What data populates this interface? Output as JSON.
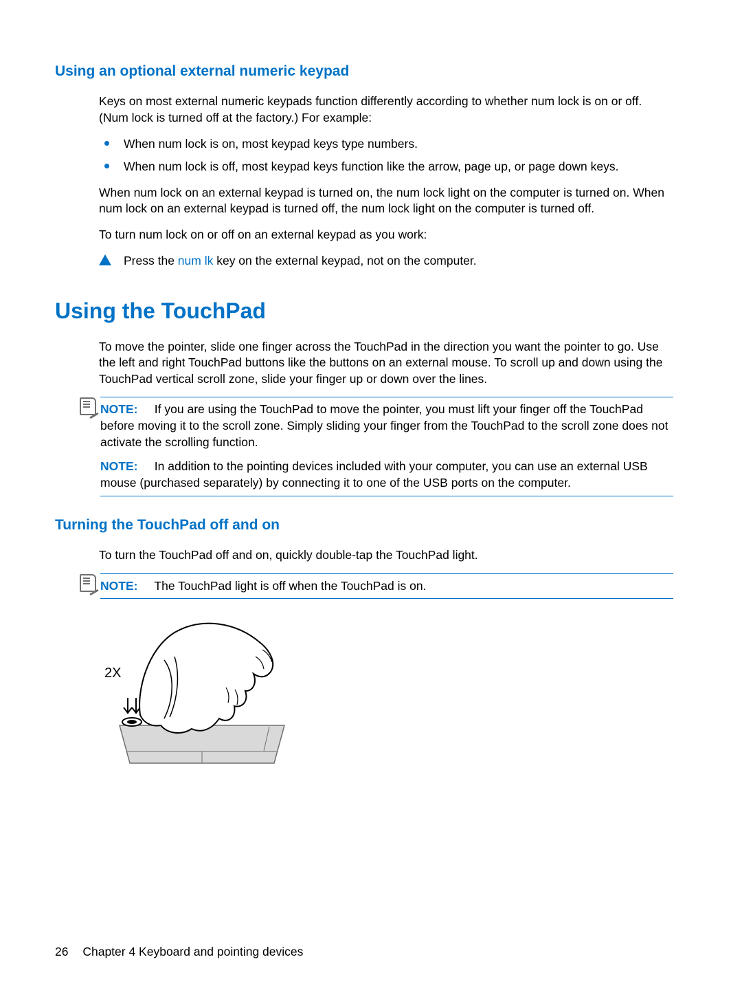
{
  "section1": {
    "heading": "Using an optional external numeric keypad",
    "intro": "Keys on most external numeric keypads function differently according to whether num lock is on or off. (Num lock is turned off at the factory.) For example:",
    "bullets": [
      "When num lock is on, most keypad keys type numbers.",
      "When num lock is off, most keypad keys function like the arrow, page up, or page down keys."
    ],
    "para2": "When num lock on an external keypad is turned on, the num lock light on the computer is turned on. When num lock on an external keypad is turned off, the num lock light on the computer is turned off.",
    "para3": "To turn num lock on or off on an external keypad as you work:",
    "caution_pre": "Press the ",
    "caution_key": "num lk",
    "caution_post": " key on the external keypad, not on the computer."
  },
  "section2": {
    "heading": "Using the TouchPad",
    "intro": "To move the pointer, slide one finger across the TouchPad in the direction you want the pointer to go. Use the left and right TouchPad buttons like the buttons on an external mouse. To scroll up and down using the TouchPad vertical scroll zone, slide your finger up or down over the lines.",
    "note_label": "NOTE:",
    "note1": "If you are using the TouchPad to move the pointer, you must lift your finger off the TouchPad before moving it to the scroll zone. Simply sliding your finger from the TouchPad to the scroll zone does not activate the scrolling function.",
    "note2": "In addition to the pointing devices included with your computer, you can use an external USB mouse (purchased separately) by connecting it to one of the USB ports on the computer."
  },
  "section3": {
    "heading": "Turning the TouchPad off and on",
    "para": "To turn the TouchPad off and on, quickly double-tap the TouchPad light.",
    "note_label": "NOTE:",
    "note": "The TouchPad light is off when the TouchPad is on.",
    "figure_label": "2X"
  },
  "footer": {
    "page": "26",
    "chapter": "Chapter 4   Keyboard and pointing devices"
  }
}
